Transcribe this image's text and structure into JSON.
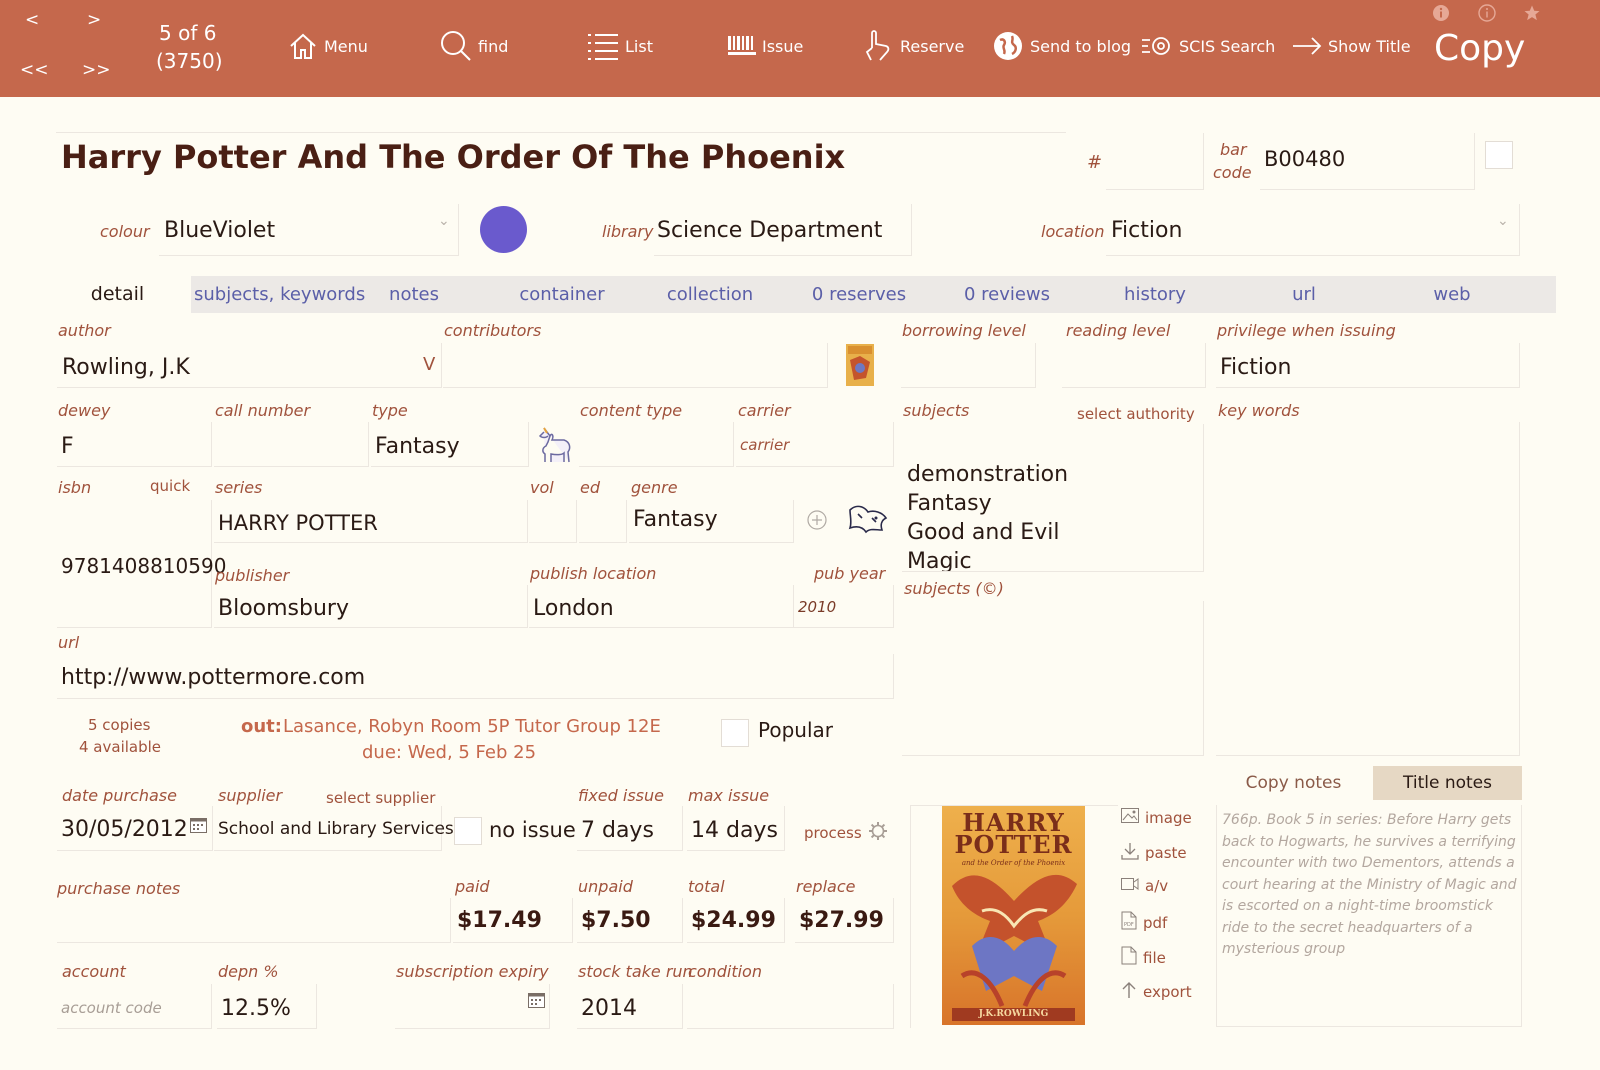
{
  "toolbar": {
    "nav_prev": "<",
    "nav_next": ">",
    "nav_first": "<<",
    "nav_last": ">>",
    "record_position": "5 of 6",
    "record_total": "(3750)",
    "menu_label": "Menu",
    "find_label": "find",
    "list_label": "List",
    "issue_label": "Issue",
    "reserve_label": "Reserve",
    "blog_label": "Send to blog",
    "scis_label": "SCIS Search",
    "show_title_label": "Show Title",
    "mode_title": "Copy",
    "icons": [
      "info-icon",
      "info-outline-icon",
      "star-icon",
      "home-icon",
      "search-icon",
      "list-icon",
      "barcode-icon",
      "reserve-hand-icon",
      "globe-icon",
      "scis-icon",
      "arrow-right-icon"
    ]
  },
  "header": {
    "title": "Harry Potter And The Order Of The Phoenix",
    "hash_label": "#",
    "barcode_label_1": "bar",
    "barcode_label_2": "code",
    "barcode_value": "B00480",
    "colour_label": "colour",
    "colour_value": "BlueViolet",
    "colour_swatch": "#6a5acd",
    "library_label": "library",
    "library_value": "Science Department",
    "location_label": "location",
    "location_value": "Fiction"
  },
  "tabs": [
    {
      "label": "detail"
    },
    {
      "label": "subjects, keywords"
    },
    {
      "label": "notes"
    },
    {
      "label": "container"
    },
    {
      "label": "collection"
    },
    {
      "label": "0 reserves"
    },
    {
      "label": "0 reviews"
    },
    {
      "label": "history"
    },
    {
      "label": "url"
    },
    {
      "label": "web"
    }
  ],
  "detail": {
    "author_label": "author",
    "author_value": "Rowling, J.K",
    "author_toggle": "V",
    "contributors_label": "contributors",
    "borrowing_level_label": "borrowing level",
    "reading_level_label": "reading level",
    "privilege_label": "privilege when issuing",
    "privilege_value": "Fiction",
    "dewey_label": "dewey",
    "dewey_value": "F",
    "call_number_label": "call number",
    "type_label": "type",
    "type_value": "Fantasy",
    "content_type_label": "content type",
    "carrier_label": "carrier",
    "carrier_placeholder": "carrier",
    "subjects_label": "subjects",
    "select_authority": "select authority",
    "key_words_label": "key words",
    "subjects": [
      "demonstration",
      "Fantasy",
      "Good and Evil",
      "Magic"
    ],
    "subjects_c_label": "subjects (©)",
    "isbn_label": "isbn",
    "quick_label": "quick",
    "isbn_value": "9781408810590",
    "series_label": "series",
    "series_value": "HARRY POTTER",
    "vol_label": "vol",
    "ed_label": "ed",
    "genre_label": "genre",
    "genre_value": "Fantasy",
    "publisher_label": "publisher",
    "publisher_value": "Bloomsbury",
    "publish_location_label": "publish location",
    "publish_location_value": "London",
    "pub_year_label": "pub year",
    "pub_year_value": "2010",
    "url_label": "url",
    "url_value": "http://www.pottermore.com",
    "copies": "5 copies",
    "available": "4 available",
    "out_label": "out:",
    "out_value": "Lasance, Robyn Room 5P Tutor Group 12E",
    "due_value": "due: Wed, 5 Feb 25",
    "popular_label": "Popular"
  },
  "purchase": {
    "date_purchase_label": "date purchase",
    "date_purchase_value": "30/05/2012",
    "supplier_label": "supplier",
    "select_supplier": "select supplier",
    "supplier_value": "School and Library Services",
    "no_issue_label": "no issue",
    "fixed_issue_label": "fixed issue",
    "fixed_issue_value": "7 days",
    "max_issue_label": "max issue",
    "max_issue_value": "14 days",
    "process_label": "process",
    "purchase_notes_label": "purchase notes",
    "paid_label": "paid",
    "paid_value": "$17.49",
    "unpaid_label": "unpaid",
    "unpaid_value": "$7.50",
    "total_label": "total",
    "total_value": "$24.99",
    "replace_label": "replace",
    "replace_value": "$27.99",
    "account_label": "account",
    "account_placeholder": "account code",
    "depn_label": "depn %",
    "depn_value": "12.5%",
    "subscription_label": "subscription expiry",
    "stock_take_label": "stock take run",
    "stock_take_value": "2014",
    "condition_label": "condition"
  },
  "media": {
    "image_label": "image",
    "paste_label": "paste",
    "av_label": "a/v",
    "pdf_label": "pdf",
    "file_label": "file",
    "export_label": "export",
    "cover_title_1": "HARRY",
    "cover_title_2": "POTTER",
    "cover_subtitle": "and the Order of the Phoenix",
    "cover_author": "J.K.ROWLING"
  },
  "notes": {
    "copy_notes_tab": "Copy notes",
    "title_notes_tab": "Title notes",
    "title_notes_text": "766p. Book 5 in series: Before Harry gets back to Hogwarts, he survives a terrifying encounter with two Dementors, attends a court hearing at the Ministry of Magic and is escorted on a night-time broomstick ride to the secret headquarters of a mysterious group"
  }
}
